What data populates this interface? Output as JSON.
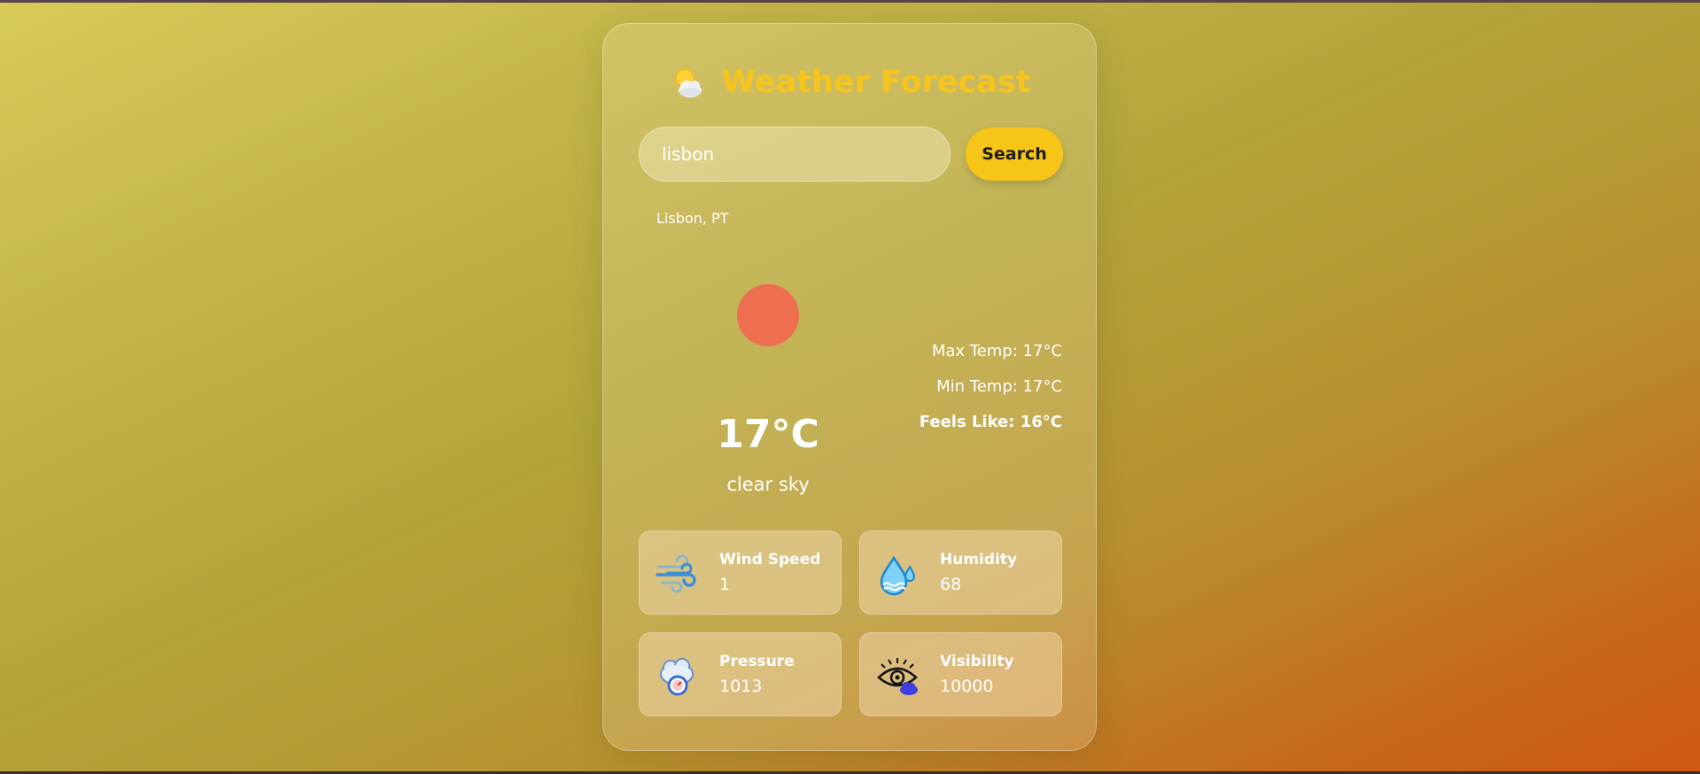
{
  "app": {
    "title": "Weather Forecast",
    "title_icon": "sun-behind-cloud-icon",
    "accent_color": "#f6c41c"
  },
  "search": {
    "value": "lisbon",
    "button_label": "Search",
    "suggestion": "Lisbon, PT"
  },
  "current": {
    "icon": "clear-sky-sun-icon",
    "temperature": "17°C",
    "description": "clear sky",
    "max_temp": "Max Temp: 17°C",
    "min_temp": "Min Temp: 17°C",
    "feels_like": "Feels Like: 16°C"
  },
  "details": [
    {
      "label": "Wind Speed",
      "value": "1",
      "icon": "wind-icon"
    },
    {
      "label": "Humidity",
      "value": "68",
      "icon": "humidity-drops-icon"
    },
    {
      "label": "Pressure",
      "value": "1013",
      "icon": "pressure-gauge-icon"
    },
    {
      "label": "Visibility",
      "value": "10000",
      "icon": "visibility-eye-icon"
    }
  ]
}
